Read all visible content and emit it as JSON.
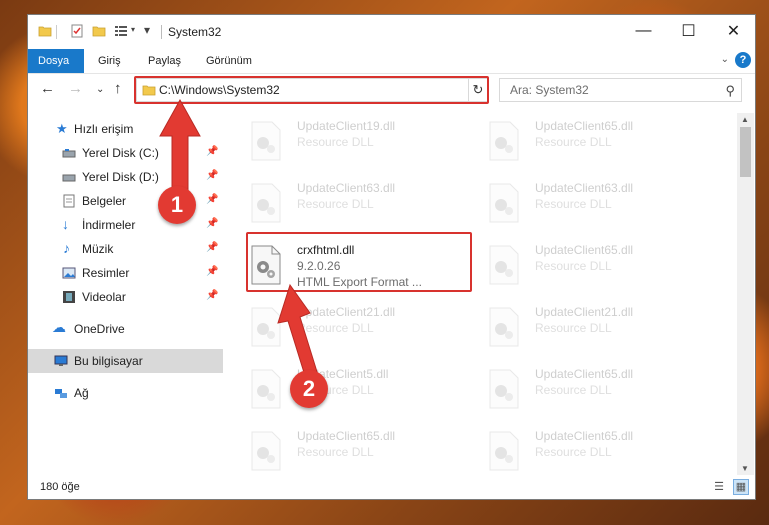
{
  "window": {
    "title": "System32"
  },
  "ribbon": {
    "tabs": [
      {
        "label": "Dosya",
        "active": true
      },
      {
        "label": "Giriş",
        "active": false
      },
      {
        "label": "Paylaş",
        "active": false
      },
      {
        "label": "Görünüm",
        "active": false
      }
    ],
    "help": "?"
  },
  "nav": {
    "address": "C:\\Windows\\System32",
    "search_placeholder": "Ara: System32"
  },
  "sidebar": {
    "quick_access": "Hızlı erişim",
    "items": [
      {
        "label": "Yerel Disk (C:)",
        "pinned": true
      },
      {
        "label": "Yerel Disk (D:)",
        "pinned": true
      },
      {
        "label": "Belgeler",
        "pinned": true
      },
      {
        "label": "İndirmeler",
        "pinned": true
      },
      {
        "label": "Müzik",
        "pinned": true
      },
      {
        "label": "Resimler",
        "pinned": true
      },
      {
        "label": "Videolar",
        "pinned": true
      }
    ],
    "onedrive": "OneDrive",
    "this_pc": "Bu bilgisayar",
    "network": "Ağ"
  },
  "files": {
    "highlighted": {
      "name": "crxfhtml.dll",
      "version": "9.2.0.26",
      "description": "HTML Export Format ..."
    },
    "left_column": [
      {
        "name": "UpdateClient19.dll",
        "type": "Resource DLL"
      },
      {
        "name": "UpdateClient63.dll",
        "type": "Resource DLL"
      },
      {
        "name": "UpdateClient21.dll",
        "type": "Resource DLL"
      },
      {
        "name": "UpdateClient5.dll",
        "type": "Resource DLL"
      },
      {
        "name": "UpdateClient65.dll",
        "type": "Resource DLL"
      }
    ],
    "right_column": [
      {
        "name": "UpdateClient65.dll",
        "type": "Resource DLL"
      },
      {
        "name": "UpdateClient63.dll",
        "type": "Resource DLL"
      },
      {
        "name": "UpdateClient65.dll",
        "type": "Resource DLL"
      },
      {
        "name": "UpdateClient21.dll",
        "type": "Resource DLL"
      },
      {
        "name": "UpdateClient65.dll",
        "type": "Resource DLL"
      },
      {
        "name": "UpdateClient65.dll",
        "type": "Resource DLL"
      }
    ]
  },
  "status": {
    "count": "180 öğe"
  },
  "annotations": {
    "step1": "1",
    "step2": "2",
    "color": "#e23a32"
  }
}
